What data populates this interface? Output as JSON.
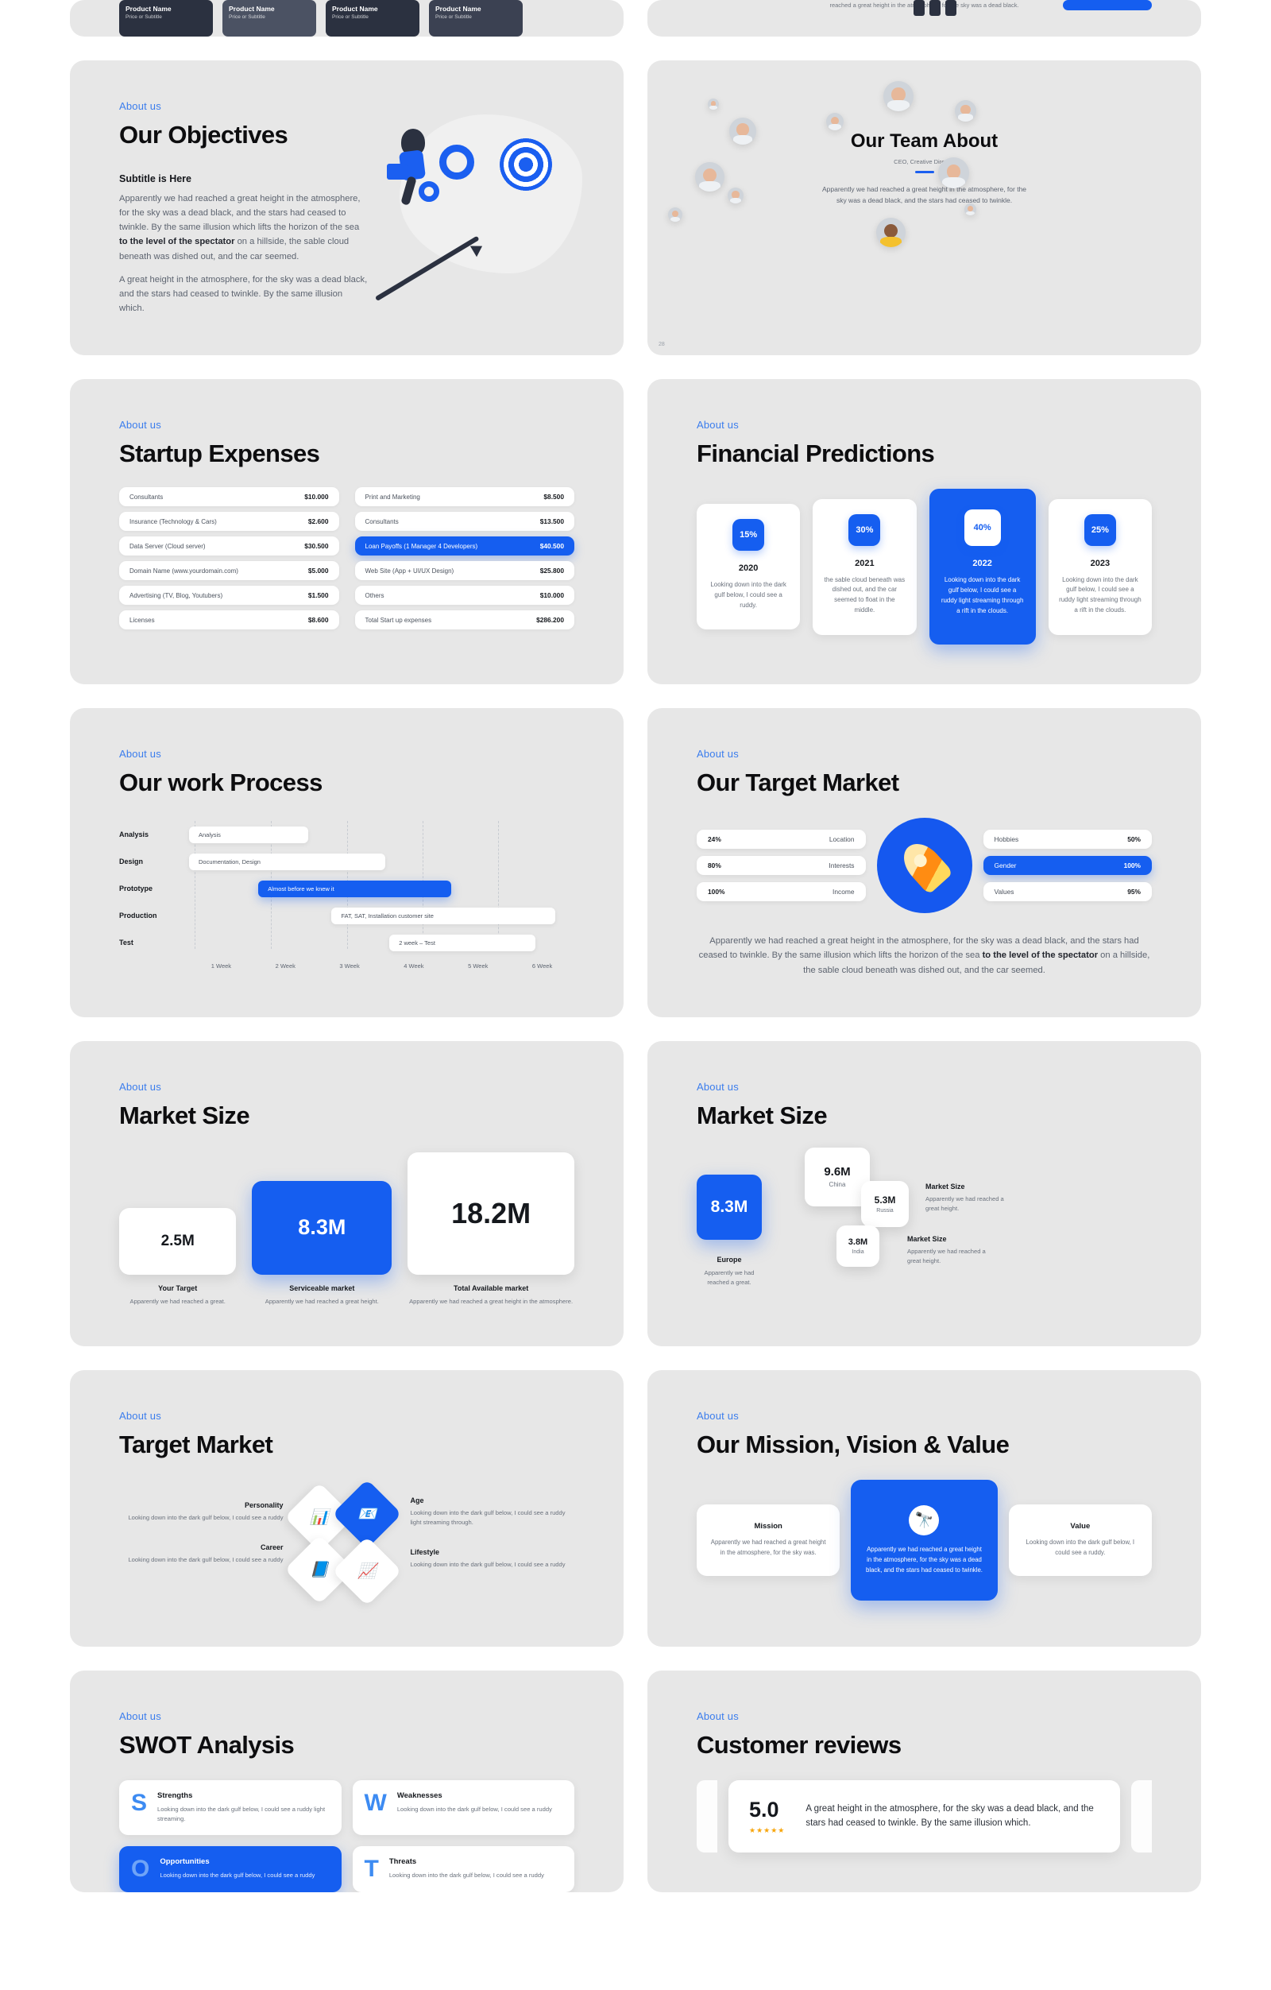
{
  "top_row": {
    "product_cards": [
      {
        "name": "Product Name",
        "sub": "Price or Subtitle"
      },
      {
        "name": "Product Name",
        "sub": "Price or Subtitle"
      },
      {
        "name": "Product Name",
        "sub": "Price or Subtitle"
      },
      {
        "name": "Product Name",
        "sub": "Price or Subtitle"
      }
    ],
    "clipped_text": "reached a great height in the atmosphere, for the sky was a dead black."
  },
  "objectives": {
    "eyebrow": "About us",
    "title": "Our Objectives",
    "subtitle": "Subtitle is Here",
    "para1_a": "Apparently we had reached a great height in the atmosphere, for the sky was a dead black, and the stars had ceased to twinkle. By the same illusion which lifts the horizon of the sea ",
    "para1_bold": "to the level of the spectator",
    "para1_b": " on a hillside, the sable cloud beneath was dished out, and the car seemed.",
    "para2": "A great height in the atmosphere, for the sky was a dead black, and the stars had ceased to twinkle. By the same illusion which."
  },
  "team": {
    "title": "Our Team About",
    "role": "CEO, Creative Director",
    "para": "Apparently we had reached a great height in the atmosphere, for the sky was a dead black, and the stars had ceased to twinkle.",
    "page_number": "28"
  },
  "expenses": {
    "eyebrow": "About us",
    "title": "Startup Expenses",
    "left": [
      {
        "label": "Consultants",
        "amount": "$10.000",
        "highlight": false
      },
      {
        "label": "Insurance (Technology & Cars)",
        "amount": "$2.600",
        "highlight": false
      },
      {
        "label": "Data Server (Cloud server)",
        "amount": "$30.500",
        "highlight": false
      },
      {
        "label": "Domain Name (www.yourdomain.com)",
        "amount": "$5.000",
        "highlight": false
      },
      {
        "label": "Advertising (TV, Blog, Youtubers)",
        "amount": "$1.500",
        "highlight": false
      },
      {
        "label": "Licenses",
        "amount": "$8.600",
        "highlight": false
      }
    ],
    "right": [
      {
        "label": "Print and Marketing",
        "amount": "$8.500",
        "highlight": false
      },
      {
        "label": "Consultants",
        "amount": "$13.500",
        "highlight": false
      },
      {
        "label": "Loan Payoffs (1 Manager 4 Developers)",
        "amount": "$40.500",
        "highlight": true
      },
      {
        "label": "Web Site (App + UI/UX Design)",
        "amount": "$25.800",
        "highlight": false
      },
      {
        "label": "Others",
        "amount": "$10.000",
        "highlight": false
      },
      {
        "label": "Total Start up expenses",
        "amount": "$286.200",
        "highlight": false
      }
    ]
  },
  "financial": {
    "eyebrow": "About us",
    "title": "Financial Predictions",
    "cards": [
      {
        "pct": "15%",
        "year": "2020",
        "text": "Looking down into the dark gulf below, I could see a ruddy.",
        "highlight": false
      },
      {
        "pct": "30%",
        "year": "2021",
        "text": "the sable cloud beneath was dished out, and the car seemed to float in the middle.",
        "highlight": false
      },
      {
        "pct": "40%",
        "year": "2022",
        "text": "Looking down into the dark gulf below, I could see a ruddy light streaming through a rift in the clouds.",
        "highlight": true
      },
      {
        "pct": "25%",
        "year": "2023",
        "text": "Looking down into the dark gulf below, I could see a ruddy light streaming through a rift in the clouds.",
        "highlight": false
      }
    ]
  },
  "process": {
    "eyebrow": "About us",
    "title": "Our work Process",
    "rows": [
      {
        "label": "Analysis",
        "bar": "Analysis",
        "start": 0,
        "span": 1.65,
        "highlight": false
      },
      {
        "label": "Design",
        "bar": "Documentation, Design",
        "start": 0,
        "span": 2.9,
        "highlight": false
      },
      {
        "label": "Prototype",
        "bar": "Almost before we knew it",
        "start": 1.05,
        "span": 2.85,
        "highlight": true
      },
      {
        "label": "Production",
        "bar": "FAT, SAT, Installation customer site",
        "start": 2.1,
        "span": 3.1,
        "highlight": false
      },
      {
        "label": "Test",
        "bar": "2 week – Test",
        "start": 3.05,
        "span": 2.1,
        "highlight": false
      }
    ],
    "ticks": [
      "1 Week",
      "2 Week",
      "3 Week",
      "4 Week",
      "5 Week",
      "6 Week"
    ]
  },
  "target_market": {
    "eyebrow": "About us",
    "title": "Our Target Market",
    "left": [
      {
        "pct": "24%",
        "label": "Location",
        "highlight": false
      },
      {
        "pct": "80%",
        "label": "Interests",
        "highlight": false
      },
      {
        "pct": "100%",
        "label": "Income",
        "highlight": false
      }
    ],
    "right": [
      {
        "label": "Hobbies",
        "pct": "50%",
        "highlight": false
      },
      {
        "label": "Gender",
        "pct": "100%",
        "highlight": true
      },
      {
        "label": "Values",
        "pct": "95%",
        "highlight": false
      }
    ],
    "icon": "rocket-icon",
    "footer_a": "Apparently we had reached a great height in the atmosphere, for the sky was a dead black, and the stars had ceased to twinkle. By the same illusion which lifts the horizon of the sea ",
    "footer_bold": "to the level of the spectator",
    "footer_b": " on a hillside, the sable cloud beneath was dished out, and the car seemed."
  },
  "market_size_1": {
    "eyebrow": "About us",
    "title": "Market Size",
    "boxes": [
      {
        "value": "2.5M",
        "caption": "Your Target",
        "text": "Apparently we had reached a great.",
        "highlight": false
      },
      {
        "value": "8.3M",
        "caption": "Serviceable market",
        "text": "Apparently we had reached a great height.",
        "highlight": true
      },
      {
        "value": "18.2M",
        "caption": "Total Available market",
        "text": "Apparently we had reached a great height in the atmosphere.",
        "highlight": false
      }
    ]
  },
  "market_size_2": {
    "eyebrow": "About us",
    "title": "Market Size",
    "cards": [
      {
        "value": "8.3M",
        "country": "Europe",
        "highlight": true
      },
      {
        "value": "9.6M",
        "country": "China",
        "highlight": false
      },
      {
        "value": "5.3M",
        "country": "Russia",
        "highlight": false
      },
      {
        "value": "3.8M",
        "country": "India",
        "highlight": false
      }
    ],
    "europe_text": "Apparently we had reached a great.",
    "notes": [
      {
        "head": "Market Size",
        "text": "Apparently we had reached a great height."
      },
      {
        "head": "Market Size",
        "text": "Apparently we had reached a great height."
      }
    ]
  },
  "target_market_2": {
    "eyebrow": "About us",
    "title": "Target Market",
    "items": [
      {
        "head": "Personality",
        "text": "Looking down into the dark gulf below, I could see a ruddy",
        "icon": "chart-bar-icon",
        "side": "left"
      },
      {
        "head": "Career",
        "text": "Looking down into the dark gulf below, I could see a ruddy",
        "icon": "book-icon",
        "side": "left"
      },
      {
        "head": "Age",
        "text": "Looking down into the dark gulf below, I could see a ruddy light streaming through.",
        "icon": "mail-icon",
        "side": "right"
      },
      {
        "head": "Lifestyle",
        "text": "Looking down into the dark gulf below, I could see a ruddy",
        "icon": "line-chart-icon",
        "side": "right"
      }
    ]
  },
  "mission": {
    "eyebrow": "About us",
    "title": "Our Mission, Vision & Value",
    "cards": [
      {
        "head": "Mission",
        "text": "Apparently we had reached a great height in the atmosphere, for the sky was.",
        "highlight": false,
        "icon": ""
      },
      {
        "head": "",
        "text": "Apparently we had reached a great height in the atmosphere, for the sky was a dead black, and the stars had ceased to twinkle.",
        "highlight": true,
        "icon": "🔭"
      },
      {
        "head": "Value",
        "text": "Looking down into the dark gulf below, I could see a ruddy.",
        "highlight": false,
        "icon": ""
      }
    ]
  },
  "swot": {
    "eyebrow": "About us",
    "title": "SWOT Analysis",
    "cards": [
      {
        "letter": "S",
        "head": "Strengths",
        "text": "Looking down into the dark gulf below, I could see a ruddy light streaming.",
        "highlight": false
      },
      {
        "letter": "W",
        "head": "Weaknesses",
        "text": "Looking down into the dark gulf below, I could see a ruddy",
        "highlight": false
      },
      {
        "letter": "O",
        "head": "Opportunities",
        "text": "Looking down into the dark gulf below, I could see a ruddy",
        "highlight": true
      },
      {
        "letter": "T",
        "head": "Threats",
        "text": "Looking down into the dark gulf below, I could see a ruddy",
        "highlight": false
      }
    ]
  },
  "reviews": {
    "eyebrow": "About us",
    "title": "Customer reviews",
    "score": "5.0",
    "stars": "★★★★★",
    "sub": "",
    "quote": "A great height in the atmosphere, for the sky was a dead black, and the stars had ceased to twinkle. By the same illusion which."
  }
}
